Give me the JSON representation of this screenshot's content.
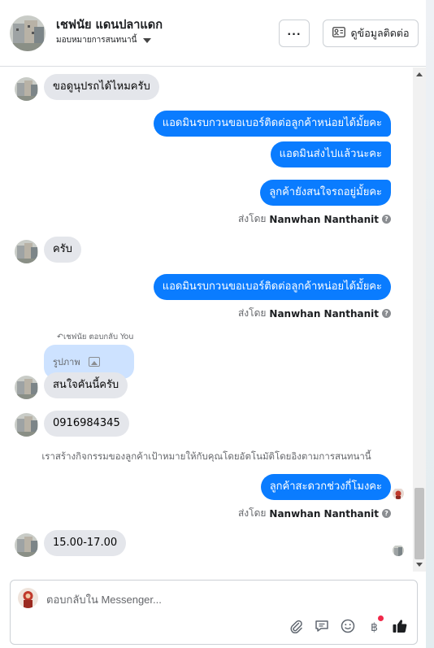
{
  "header": {
    "contact_name": "เชฟนัย แดนปลาแดก",
    "assign_label": "มอบหมายการสนทนานี้",
    "more_label": "···",
    "contact_info_label": "ดูข้อมูลติดต่อ"
  },
  "messages": {
    "m1": "ขอดูนุปรถได้ไหมครับ",
    "m2": "แอดมินรบกวนขอเบอร์ติดต่อลูกค้าหน่อยได้มั้ยคะ",
    "m3": "แอดมินส่งไปแล้วนะคะ",
    "m4": "ลูกค้ายังสนใจรถอยู่มั้ยคะ",
    "m5": "ครับ",
    "m6": "แอดมินรบกวนขอเบอร์ติดต่อลูกค้าหน่อยได้มั้ยคะ",
    "m7": "สนใจคันนี้ครับ",
    "m8": "0916984345",
    "m9": "ลูกค้าสะดวกช่วงกี่โมงคะ",
    "m10": "15.00-17.00"
  },
  "sent_by": {
    "prefix": "ส่งโดย",
    "name": "Nanwhan Nanthanit"
  },
  "reply": {
    "label": "เชฟนัย ตอบกลับ You",
    "quoted": "รูปภาพ"
  },
  "system_notice": "เราสร้างกิจกรรมของลูกค้าเป้าหมายให้กับคุณโดยอัตโนมัติโดยอิงตามการสนทนานี้",
  "composer": {
    "placeholder": "ตอบกลับใน Messenger..."
  },
  "colors": {
    "outgoing": "#0a7cff",
    "incoming": "#e4e6eb",
    "notify_dot": "#f02849"
  },
  "icons": [
    "more-icon",
    "contact-card-icon",
    "info-icon",
    "image-icon",
    "attach-icon",
    "saved-reply-icon",
    "emoji-icon",
    "baht-icon",
    "like-icon"
  ]
}
